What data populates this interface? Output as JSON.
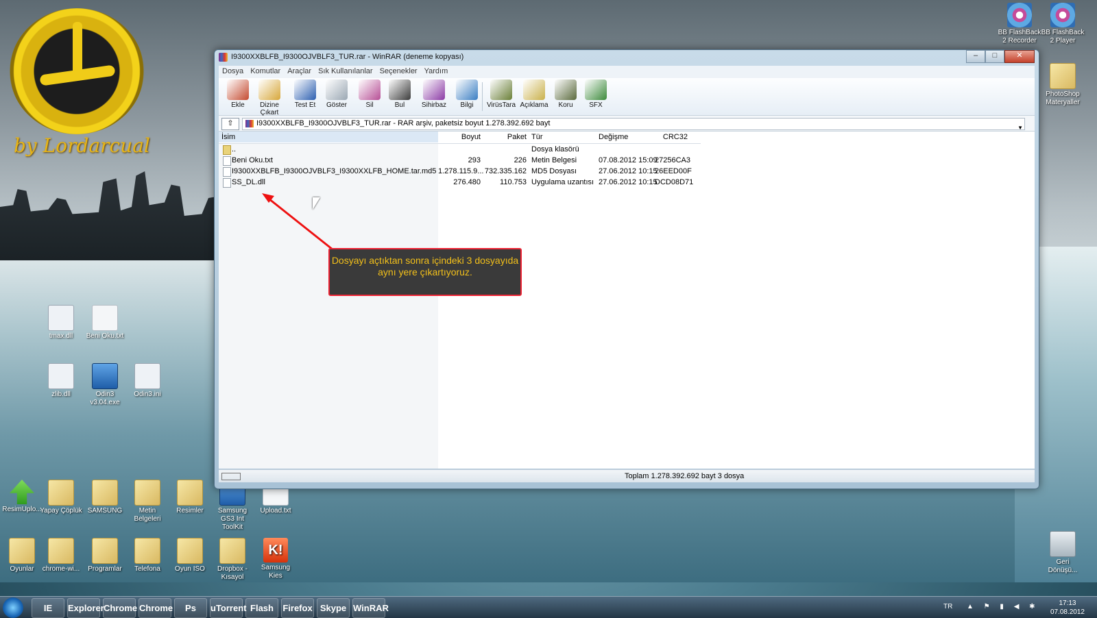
{
  "wallpaper": {
    "logo_text": "by Lordarcual"
  },
  "desktop_icons": [
    {
      "name": "tmax.dll",
      "kind": "dll"
    },
    {
      "name": "Beni Oku.txt",
      "kind": "file"
    },
    {
      "name": "zlib.dll",
      "kind": "dll"
    },
    {
      "name": "Odin3 v3.04.exe",
      "kind": "app"
    },
    {
      "name": "Odin3.ini",
      "kind": "dll"
    },
    {
      "name": "ResimUplo...",
      "kind": "green"
    },
    {
      "name": "Yapay Çöplük",
      "kind": "folder"
    },
    {
      "name": "SAMSUNG",
      "kind": "folder"
    },
    {
      "name": "Metin Belgeleri",
      "kind": "folder"
    },
    {
      "name": "Resimler",
      "kind": "folder"
    },
    {
      "name": "Samsung GS3 Int ToolKit",
      "kind": "app"
    },
    {
      "name": "Upload.txt",
      "kind": "file"
    },
    {
      "name": "Oyunlar",
      "kind": "folder"
    },
    {
      "name": "chrome-wi...",
      "kind": "folder"
    },
    {
      "name": "Programlar",
      "kind": "folder"
    },
    {
      "name": "Telefona",
      "kind": "folder"
    },
    {
      "name": "Oyun ISO",
      "kind": "folder"
    },
    {
      "name": "Dropbox - Kısayol",
      "kind": "folder"
    },
    {
      "name": "Samsung Kies",
      "kind": "red"
    },
    {
      "name": "BB FlashBack 2 Recorder",
      "kind": "disc"
    },
    {
      "name": "BB FlashBack 2 Player",
      "kind": "disc"
    },
    {
      "name": "PhotoShop Materyaller",
      "kind": "folder"
    },
    {
      "name": "Geri Dönüşü...",
      "kind": "bin"
    }
  ],
  "window": {
    "title": "I9300XXBLFB_I9300OJVBLF3_TUR.rar - WinRAR (deneme kopyası)",
    "buttons": {
      "min": "–",
      "max": "□",
      "close": "✕"
    },
    "menu": [
      "Dosya",
      "Komutlar",
      "Araçlar",
      "Sık Kullanılanlar",
      "Seçenekler",
      "Yardım"
    ],
    "toolbar": [
      {
        "label": "Ekle",
        "icon": "add-archive-icon",
        "color": "#c44a2f"
      },
      {
        "label": "Dizine Çıkart",
        "icon": "extract-icon",
        "color": "#d7a73a"
      },
      {
        "label": "Test Et",
        "icon": "test-icon",
        "color": "#2c5fb0"
      },
      {
        "label": "Göster",
        "icon": "view-icon",
        "color": "#9aa7b3"
      },
      {
        "label": "Sil",
        "icon": "delete-icon",
        "color": "#b64e95"
      },
      {
        "label": "Bul",
        "icon": "find-icon",
        "color": "#3b3b3b"
      },
      {
        "label": "Sihirbaz",
        "icon": "wizard-icon",
        "color": "#8b3aa5"
      },
      {
        "label": "Bilgi",
        "icon": "info-icon",
        "color": "#3a7ec2"
      },
      {
        "label": "VirüsTara",
        "icon": "virus-scan-icon",
        "color": "#6a7f37"
      },
      {
        "label": "Açıklama",
        "icon": "comment-icon",
        "color": "#c9b04a"
      },
      {
        "label": "Koru",
        "icon": "protect-icon",
        "color": "#5a6a3c"
      },
      {
        "label": "SFX",
        "icon": "sfx-icon",
        "color": "#3c8a3b"
      }
    ],
    "address": "I9300XXBLFB_I9300OJVBLF3_TUR.rar - RAR arşiv, paketsiz boyut 1.278.392.692 bayt",
    "columns": {
      "name": "İsim",
      "size": "Boyut",
      "packed": "Paket",
      "type": "Tür",
      "modified": "Değişme",
      "crc": "CRC32"
    },
    "rows": [
      {
        "name": "..",
        "size": "",
        "packed": "",
        "type": "Dosya klasörü",
        "modified": "",
        "crc": "",
        "folder": true
      },
      {
        "name": "Beni Oku.txt",
        "size": "293",
        "packed": "226",
        "type": "Metin Belgesi",
        "modified": "07.08.2012 15:09",
        "crc": "27256CA3",
        "folder": false
      },
      {
        "name": "I9300XXBLFB_I9300OJVBLF3_I9300XXLFB_HOME.tar.md5",
        "size": "1.278.115.9...",
        "packed": "732.335.162",
        "type": "MD5 Dosyası",
        "modified": "27.06.2012 10:15",
        "crc": "26EED00F",
        "folder": false
      },
      {
        "name": "SS_DL.dll",
        "size": "276.480",
        "packed": "110.753",
        "type": "Uygulama uzantısı",
        "modified": "27.06.2012 10:15",
        "crc": "DCD08D71",
        "folder": false
      }
    ],
    "status": "Toplam 1.278.392.692 bayt 3 dosya"
  },
  "callout": {
    "text": "Dosyayı açtıktan sonra içindeki 3 dosyayıda aynı yere çıkartıyoruz."
  },
  "taskbar": {
    "apps": [
      "IE",
      "Explorer",
      "Chrome",
      "Chrome",
      "Ps",
      "uTorrent",
      "Flash",
      "Firefox",
      "Skype",
      "WinRAR"
    ],
    "lang": "TR",
    "time": "17:13",
    "date": "07.08.2012"
  }
}
